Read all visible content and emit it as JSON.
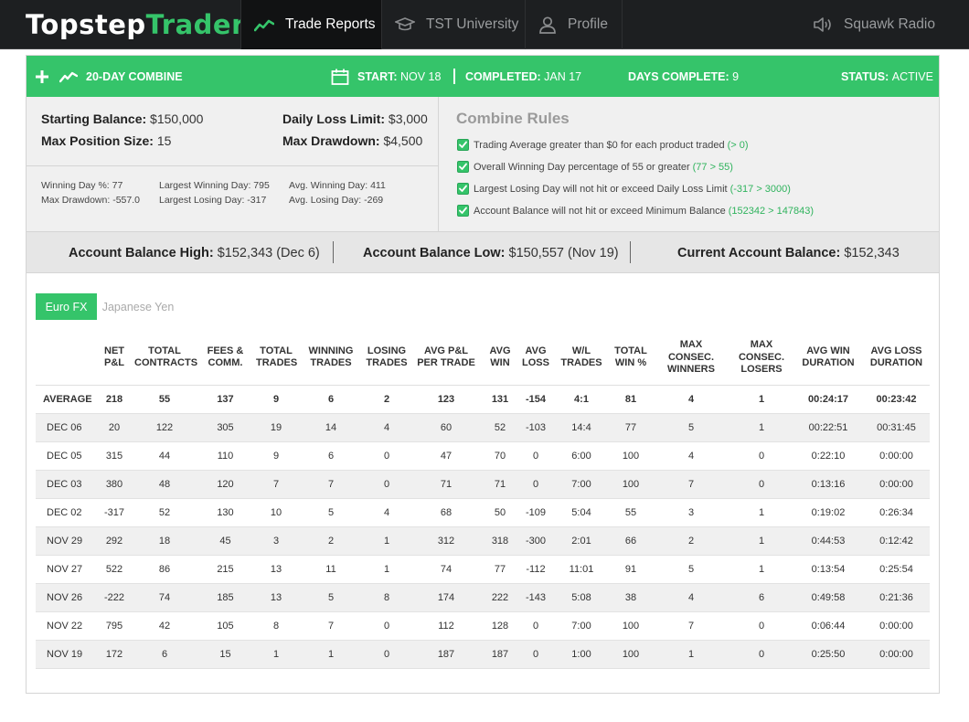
{
  "brand": {
    "part1": "Topstep",
    "part2": "Trader"
  },
  "nav": {
    "trade_reports": "Trade Reports",
    "tst_university": "TST University",
    "profile": "Profile",
    "squawk_radio": "Squawk Radio"
  },
  "combine": {
    "title": "20-DAY COMBINE",
    "start_label": "START:",
    "start_value": "NOV 18",
    "completed_label": "COMPLETED:",
    "completed_value": "JAN 17",
    "days_label": "DAYS COMPLETE:",
    "days_value": "9",
    "status_label": "STATUS:",
    "status_value": "ACTIVE"
  },
  "account": {
    "starting_balance_label": "Starting Balance:",
    "starting_balance": "$150,000",
    "max_position_label": "Max Position Size:",
    "max_position": "15",
    "daily_loss_label": "Daily Loss Limit:",
    "daily_loss": "$3,000",
    "max_drawdown_label": "Max Drawdown:",
    "max_drawdown": "$4,500"
  },
  "stats": {
    "winning_day_pct": "Winning Day %: 77",
    "max_drawdown": "Max Drawdown: -557.0",
    "largest_winning_day": "Largest Winning Day: 795",
    "largest_losing_day": "Largest Losing Day: -317",
    "avg_winning_day": "Avg. Winning Day: 411",
    "avg_losing_day": "Avg. Losing Day: -269"
  },
  "rules": {
    "title": "Combine Rules",
    "items": [
      {
        "text": "Trading Average greater than $0 for each product traded",
        "result": "(> 0)"
      },
      {
        "text": "Overall Winning Day percentage of 55 or greater",
        "result": "(77 > 55)"
      },
      {
        "text": "Largest Losing Day will not hit or exceed Daily Loss Limit",
        "result": "(-317 > 3000)"
      },
      {
        "text": "Account Balance will not hit or exceed Minimum Balance",
        "result": "(152342 > 147843)"
      }
    ]
  },
  "balances": {
    "high_label": "Account Balance High:",
    "high_value": "$152,343 (Dec 6)",
    "low_label": "Account Balance Low:",
    "low_value": "$150,557 (Nov 19)",
    "current_label": "Current Account Balance:",
    "current_value": "$152,343"
  },
  "tabs": [
    "Euro FX",
    "Japanese Yen"
  ],
  "table": {
    "headers": [
      "",
      "NET\nP&L",
      "TOTAL\nCONTRACTS",
      "FEES &\nCOMM.",
      "TOTAL\nTRADES",
      "WINNING\nTRADES",
      "LOSING\nTRADES",
      "AVG P&L\nPER TRADE",
      "AVG\nWIN",
      "AVG\nLOSS",
      "W/L\nTRADES",
      "TOTAL\nWIN %",
      "MAX\nCONSEC.\nWINNERS",
      "MAX\nCONSEC.\nLOSERS",
      "AVG WIN\nDURATION",
      "AVG LOSS\nDURATION"
    ],
    "rows": [
      [
        "AVERAGE",
        "218",
        "55",
        "137",
        "9",
        "6",
        "2",
        "123",
        "131",
        "-154",
        "4:1",
        "81",
        "4",
        "1",
        "00:24:17",
        "00:23:42"
      ],
      [
        "DEC 06",
        "20",
        "122",
        "305",
        "19",
        "14",
        "4",
        "60",
        "52",
        "-103",
        "14:4",
        "77",
        "5",
        "1",
        "00:22:51",
        "00:31:45"
      ],
      [
        "DEC 05",
        "315",
        "44",
        "110",
        "9",
        "6",
        "0",
        "47",
        "70",
        "0",
        "6:00",
        "100",
        "4",
        "0",
        "0:22:10",
        "0:00:00"
      ],
      [
        "DEC 03",
        "380",
        "48",
        "120",
        "7",
        "7",
        "0",
        "71",
        "71",
        "0",
        "7:00",
        "100",
        "7",
        "0",
        "0:13:16",
        "0:00:00"
      ],
      [
        "DEC 02",
        "-317",
        "52",
        "130",
        "10",
        "5",
        "4",
        "68",
        "50",
        "-109",
        "5:04",
        "55",
        "3",
        "1",
        "0:19:02",
        "0:26:34"
      ],
      [
        "NOV 29",
        "292",
        "18",
        "45",
        "3",
        "2",
        "1",
        "312",
        "318",
        "-300",
        "2:01",
        "66",
        "2",
        "1",
        "0:44:53",
        "0:12:42"
      ],
      [
        "NOV 27",
        "522",
        "86",
        "215",
        "13",
        "11",
        "1",
        "74",
        "77",
        "-112",
        "11:01",
        "91",
        "5",
        "1",
        "0:13:54",
        "0:25:54"
      ],
      [
        "NOV 26",
        "-222",
        "74",
        "185",
        "13",
        "5",
        "8",
        "174",
        "222",
        "-143",
        "5:08",
        "38",
        "4",
        "6",
        "0:49:58",
        "0:21:36"
      ],
      [
        "NOV 22",
        "795",
        "42",
        "105",
        "8",
        "7",
        "0",
        "112",
        "128",
        "0",
        "7:00",
        "100",
        "7",
        "0",
        "0:06:44",
        "0:00:00"
      ],
      [
        "NOV 19",
        "172",
        "6",
        "15",
        "1",
        "1",
        "0",
        "187",
        "187",
        "0",
        "1:00",
        "100",
        "1",
        "0",
        "0:25:50",
        "0:00:00"
      ]
    ]
  },
  "colors": {
    "accent": "#35c46a",
    "nav_bg": "#1d1f21",
    "result_green": "#2fb35d"
  },
  "icons": {
    "trade_reports": "chart-line-icon",
    "tst_university": "graduation-cap-icon",
    "profile": "user-icon",
    "squawk_radio": "speaker-icon",
    "combine_plus": "plus-icon",
    "combine_title": "chart-line-icon",
    "start": "calendar-icon",
    "rule": "checkbox-checked-icon"
  }
}
